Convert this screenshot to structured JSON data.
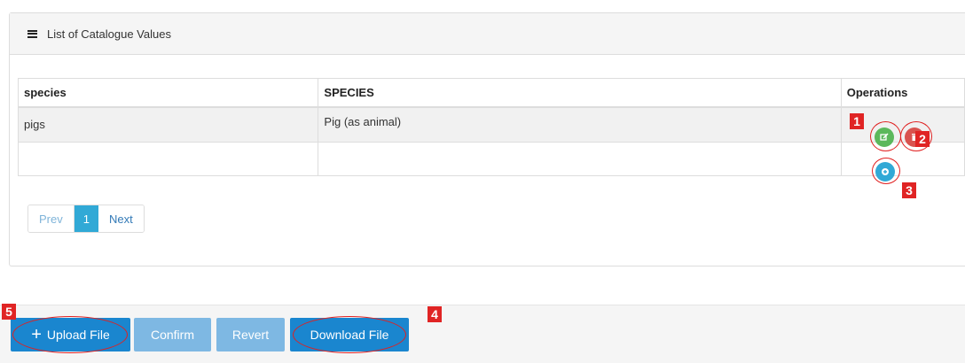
{
  "panel": {
    "title": "List of Catalogue Values"
  },
  "table": {
    "headers": [
      "species",
      "SPECIES",
      "Operations"
    ],
    "rows": [
      {
        "code": "pigs",
        "label": "Pig (as animal)"
      },
      {
        "code": "",
        "label": ""
      }
    ]
  },
  "pagination": {
    "prev": "Prev",
    "current": "1",
    "next": "Next"
  },
  "footer": {
    "upload_plus": "+",
    "upload_label": "Upload File",
    "confirm_label": "Confirm",
    "revert_label": "Revert",
    "download_label": "Download File"
  },
  "annotations": {
    "m1": "1",
    "m2": "2",
    "m3": "3",
    "m4": "4",
    "m5": "5"
  },
  "colors": {
    "edit": "#5cb85c",
    "delete": "#d9534f",
    "add": "#31a9d6",
    "primary": "#1a86cf",
    "disabled": "#7eb8e3",
    "marker": "#e02424"
  },
  "icons": {
    "list": "list-icon",
    "edit": "pencil-icon",
    "delete": "trash-icon",
    "add": "plus-circle-icon"
  }
}
